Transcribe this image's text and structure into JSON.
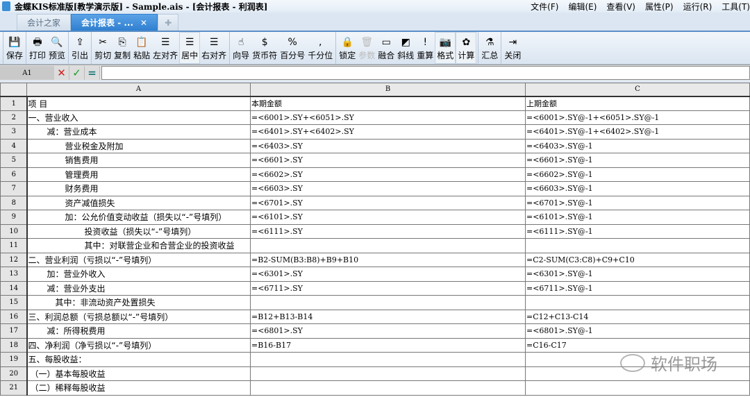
{
  "window": {
    "title": "金蝶KIS标准版[教学演示版] - Sample.ais - [会计报表 - 利润表]"
  },
  "menu": [
    "文件(F)",
    "编辑(E)",
    "查看(V)",
    "属性(P)",
    "运行(R)",
    "工具(T)"
  ],
  "tabs": [
    {
      "label": "会计之家"
    },
    {
      "label": "会计报表 - ...",
      "close": "✕"
    },
    {
      "label": "✚"
    }
  ],
  "toolbar": [
    [
      {
        "label": "保存",
        "icon": "💾"
      }
    ],
    [
      {
        "label": "打印",
        "icon": "🖶"
      },
      {
        "label": "预览",
        "icon": "🔍"
      }
    ],
    [
      {
        "label": "引出",
        "icon": "⇪"
      }
    ],
    [
      {
        "label": "剪切",
        "icon": "✂"
      },
      {
        "label": "复制",
        "icon": "⎘"
      },
      {
        "label": "粘贴",
        "icon": "📋"
      },
      {
        "label": "左对齐",
        "icon": "☰"
      },
      {
        "label": "居中",
        "icon": "☰"
      },
      {
        "label": "右对齐",
        "icon": "☰"
      }
    ],
    [
      {
        "label": "向导",
        "icon": "☝"
      },
      {
        "label": "货币符",
        "icon": "$"
      },
      {
        "label": "百分号",
        "icon": "%"
      },
      {
        "label": "千分位",
        "icon": ","
      }
    ],
    [
      {
        "label": "锁定",
        "icon": "🔒"
      },
      {
        "label": "参数",
        "icon": "🗑"
      },
      {
        "label": "融合",
        "icon": "▭"
      },
      {
        "label": "斜线",
        "icon": "◩"
      },
      {
        "label": "重算",
        "icon": "!"
      },
      {
        "label": "格式",
        "icon": "📷"
      },
      {
        "label": "计算",
        "icon": "✿"
      }
    ],
    [
      {
        "label": "汇总",
        "icon": "⚗"
      }
    ],
    [
      {
        "label": "关闭",
        "icon": "⇥"
      }
    ]
  ],
  "formula_bar": {
    "cell_ref": "A1",
    "cancel": "✕",
    "confirm": "✓",
    "equals": "=",
    "value": ""
  },
  "columns": [
    "A",
    "B",
    "C"
  ],
  "rows": [
    {
      "n": "1",
      "a": "项      目",
      "b": "本期金额",
      "c": "上期金额",
      "ind": 0
    },
    {
      "n": "2",
      "a": "一、营业收入",
      "b": "=<6001>.SY+<6051>.SY",
      "c": "=<6001>.SY@-1+<6051>.SY@-1",
      "ind": 0
    },
    {
      "n": "3",
      "a": "减：营业成本",
      "b": "=<6401>.SY+<6402>.SY",
      "c": "=<6401>.SY@-1+<6402>.SY@-1",
      "ind": 1
    },
    {
      "n": "4",
      "a": "营业税金及附加",
      "b": "=<6403>.SY",
      "c": "=<6403>.SY@-1",
      "ind": 2
    },
    {
      "n": "5",
      "a": "销售费用",
      "b": "=<6601>.SY",
      "c": "=<6601>.SY@-1",
      "ind": 2
    },
    {
      "n": "6",
      "a": "管理费用",
      "b": "=<6602>.SY",
      "c": "=<6602>.SY@-1",
      "ind": 2
    },
    {
      "n": "7",
      "a": "财务费用",
      "b": "=<6603>.SY",
      "c": "=<6603>.SY@-1",
      "ind": 2
    },
    {
      "n": "8",
      "a": "资产减值损失",
      "b": "=<6701>.SY",
      "c": "=<6701>.SY@-1",
      "ind": 2
    },
    {
      "n": "9",
      "a": "加：公允价值变动收益（损失以“-”号填列）",
      "b": "=<6101>.SY",
      "c": "=<6101>.SY@-1",
      "ind": 2
    },
    {
      "n": "10",
      "a": "投资收益（损失以“-”号填列）",
      "b": "=<6111>.SY",
      "c": "=<6111>.SY@-1",
      "ind": 3
    },
    {
      "n": "11",
      "a": "其中：对联营企业和合营企业的投资收益",
      "b": "",
      "c": "",
      "ind": 3
    },
    {
      "n": "12",
      "a": "二、营业利润（亏损以“-”号填列）",
      "b": "=B2-SUM(B3:B8)+B9+B10",
      "c": "=C2-SUM(C3:C8)+C9+C10",
      "ind": 0
    },
    {
      "n": "13",
      "a": "加：营业外收入",
      "b": "=<6301>.SY",
      "c": "=<6301>.SY@-1",
      "ind": 1
    },
    {
      "n": "14",
      "a": "减：营业外支出",
      "b": "=<6711>.SY",
      "c": "=<6711>.SY@-1",
      "ind": 1
    },
    {
      "n": "15",
      "a": "其中：非流动资产处置损失",
      "b": "",
      "c": "",
      "ind": 4
    },
    {
      "n": "16",
      "a": "三、利润总额（亏损总额以“-”号填列）",
      "b": "=B12+B13-B14",
      "c": "=C12+C13-C14",
      "ind": 0
    },
    {
      "n": "17",
      "a": "减：所得税费用",
      "b": "=<6801>.SY",
      "c": "=<6801>.SY@-1",
      "ind": 1
    },
    {
      "n": "18",
      "a": "四、净利润（净亏损以“-”号填列）",
      "b": "=B16-B17",
      "c": "=C16-C17",
      "ind": 0
    },
    {
      "n": "19",
      "a": "五、每股收益：",
      "b": "",
      "c": "",
      "ind": 0
    },
    {
      "n": "20",
      "a": "（一）基本每股收益",
      "b": "",
      "c": "",
      "ind": 5
    },
    {
      "n": "21",
      "a": "（二）稀释每股收益",
      "b": "",
      "c": "",
      "ind": 5
    }
  ],
  "watermark": "软件职场"
}
